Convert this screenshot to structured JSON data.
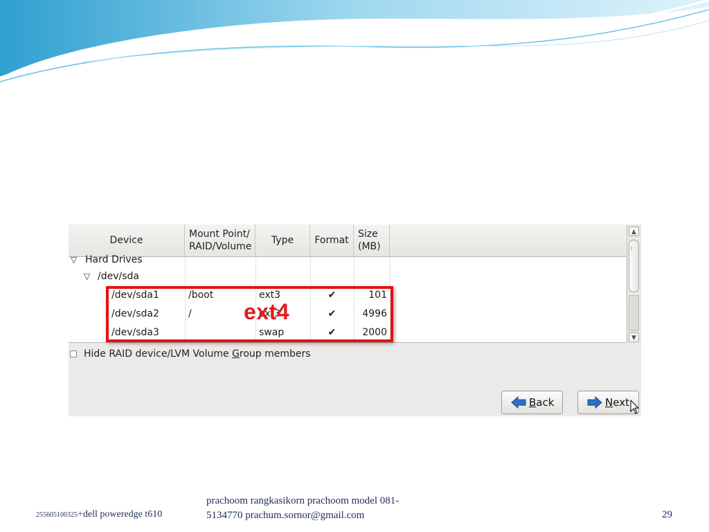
{
  "table": {
    "headers": [
      "Device",
      "Mount Point/\nRAID/Volume",
      "Type",
      "Format",
      "Size\n(MB)"
    ],
    "header_device": "Device",
    "header_mount_1": "Mount Point/",
    "header_mount_2": "RAID/Volume",
    "header_type": "Type",
    "header_format": "Format",
    "header_size_1": "Size",
    "header_size_2": "(MB)",
    "group_hard_drives": "Hard Drives",
    "disk": "/dev/sda",
    "rows": [
      {
        "device": "/dev/sda1",
        "mount": "/boot",
        "type": "ext3",
        "format": "✔",
        "size": "101"
      },
      {
        "device": "/dev/sda2",
        "mount": "/",
        "type": "ext3",
        "format": "✔",
        "size": "4996"
      },
      {
        "device": "/dev/sda3",
        "mount": "",
        "type": "swap",
        "format": "✔",
        "size": "2000"
      }
    ]
  },
  "annotation": {
    "label": "ext4",
    "color": "#e31b1b"
  },
  "options": {
    "hide_raid_pre": "Hide RAID device/LVM Volume ",
    "hide_raid_ul": "G",
    "hide_raid_post": "roup members",
    "hide_raid_checked": false
  },
  "buttons": {
    "back_ul": "B",
    "back_rest": "ack",
    "next_ul": "N",
    "next_rest": "ext"
  },
  "footer": {
    "left_small": "255605100325",
    "left_main": "+dell poweredge t610",
    "mid_line1": "prachoom rangkasikorn  prachoom model 081-",
    "mid_line2": "5134770 prachum.sornor@gmail.com",
    "page_number": "29"
  },
  "colors": {
    "accent_blue": "#3fa9d6",
    "footer_text": "#1f2c5a",
    "highlight_red": "#e41212"
  }
}
